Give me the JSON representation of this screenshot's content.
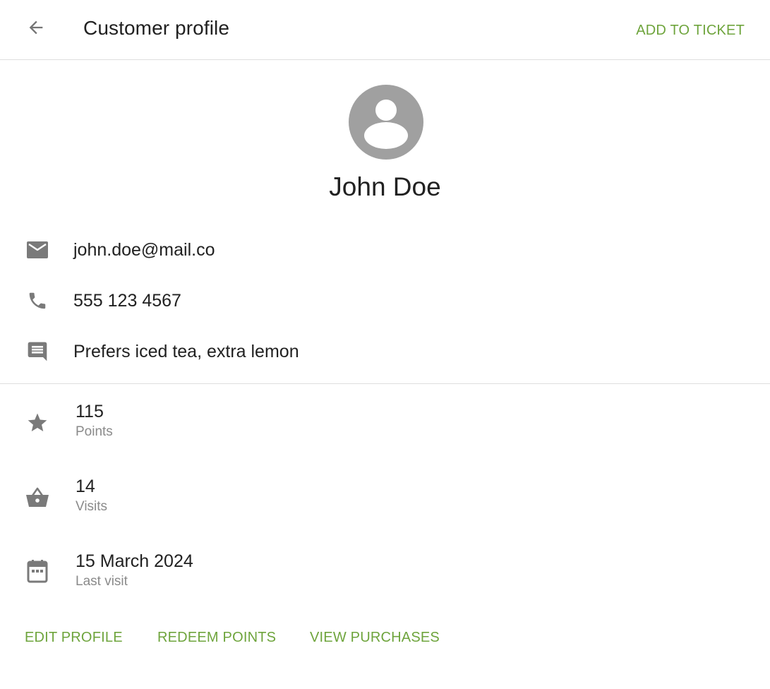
{
  "header": {
    "title": "Customer profile",
    "add_to_ticket": "ADD TO TICKET"
  },
  "profile": {
    "name": "John Doe"
  },
  "contact": {
    "email": "john.doe@mail.co",
    "phone": "555 123 4567",
    "note": "Prefers iced tea, extra lemon"
  },
  "stats": [
    {
      "value": "115",
      "label": "Points",
      "icon": "star-icon"
    },
    {
      "value": "14",
      "label": "Visits",
      "icon": "basket-icon"
    },
    {
      "value": "15 March 2024",
      "label": "Last visit",
      "icon": "calendar-icon"
    }
  ],
  "actions": {
    "edit_profile": "EDIT PROFILE",
    "redeem_points": "REDEEM POINTS",
    "view_purchases": "VIEW PURCHASES"
  },
  "colors": {
    "accent": "#6ea43c",
    "icon": "#7a7a7a",
    "avatar": "#a0a0a0",
    "divider": "#dedede"
  }
}
